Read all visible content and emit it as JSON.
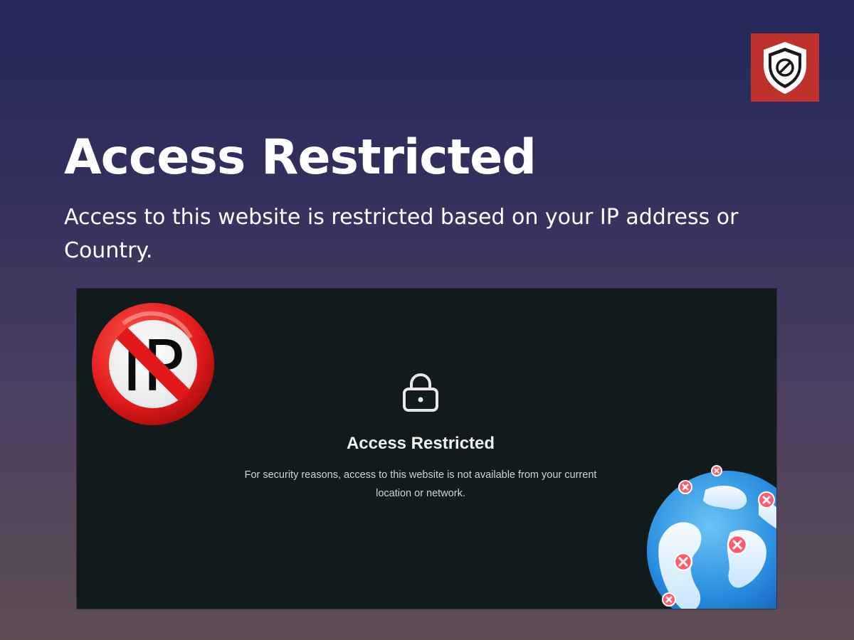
{
  "header": {
    "title": "Access Restricted",
    "description": "Access to this website is restricted based on your IP address or Country."
  },
  "badge": {
    "icon": "shield-block-icon",
    "color": "#c0312b"
  },
  "preview": {
    "title": "Access Restricted",
    "message": "For security reasons, access to this website is not available from your current location or network.",
    "ip_sign_text": "IP",
    "icons": [
      "no-ip-sign-icon",
      "lock-icon",
      "globe-icon"
    ],
    "background": "#111b1b"
  }
}
